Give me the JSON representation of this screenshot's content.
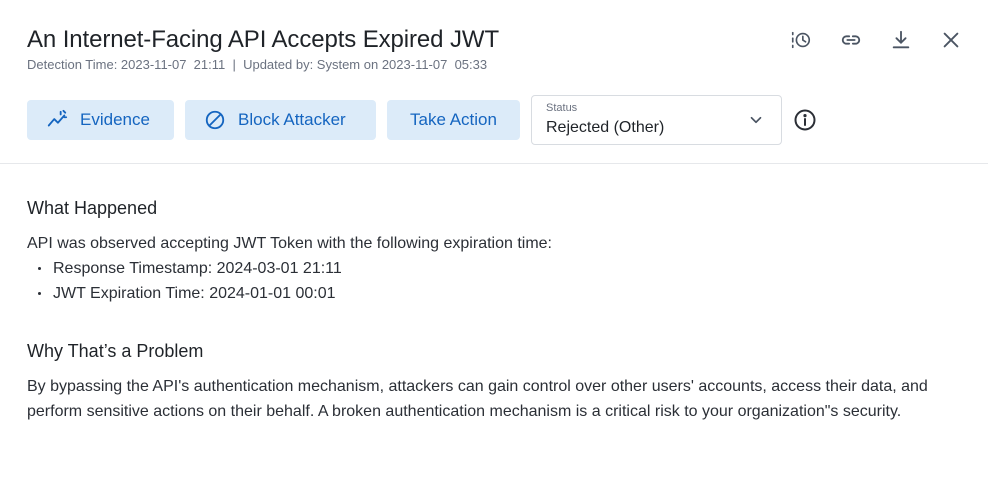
{
  "header": {
    "title": "An Internet-Facing API Accepts Expired JWT",
    "meta": "Detection Time: 2023-11-07  21:11  |  Updated by: System on 2023-11-07  05:33"
  },
  "toolbar": {
    "evidence_label": "Evidence",
    "block_label": "Block Attacker",
    "action_label": "Take Action",
    "status_label": "Status",
    "status_value": "Rejected (Other)"
  },
  "header_icons": [
    "history-icon",
    "link-icon",
    "download-icon",
    "close-icon"
  ],
  "content": {
    "what_happened": {
      "heading": "What Happened",
      "intro": "API was observed accepting JWT Token with the following expiration time:",
      "bullets": [
        "Response Timestamp: 2024-03-01  21:11",
        "JWT Expiration Time: 2024-01-01  00:01"
      ]
    },
    "why_problem": {
      "heading": "Why That’s a Problem",
      "body": "By bypassing the API's authentication mechanism, attackers can gain control over other users' accounts, access their data, and perform sensitive actions on their behalf. A broken authentication mechanism is a critical risk to your organization\"s security."
    }
  },
  "colors": {
    "accent": "#1565c0",
    "button_bg": "#dcebf9",
    "divider": "#e6e8eb"
  }
}
